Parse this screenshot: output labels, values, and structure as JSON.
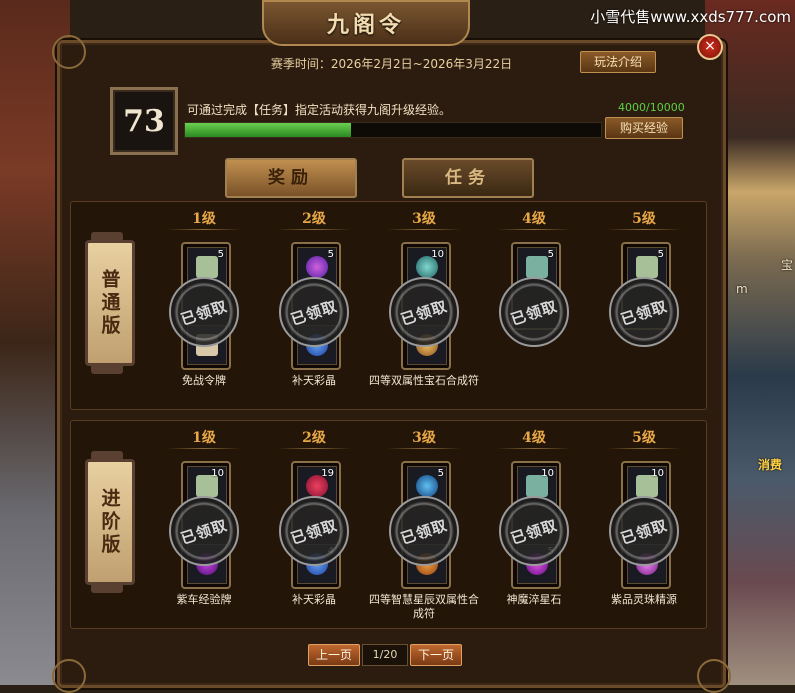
{
  "watermark": "小雪代售www.xxds777.com",
  "side_texts": {
    "left_sym": "宝",
    "right_m": "m",
    "right_consume": "消费"
  },
  "window": {
    "title": "九阁令",
    "close": "×",
    "season": "赛季时间：2026年2月2日~2026年3月22日",
    "rules_button": "玩法介绍",
    "level": "73",
    "exp_desc": "可通过完成【任务】指定活动获得九阁升级经验。",
    "exp_count": "4000/10000",
    "exp_progress": 0.4,
    "buy_button": "购买经验",
    "tabs": [
      "奖励",
      "任务"
    ]
  },
  "tiers": [
    {
      "label": "普通版",
      "columns": [
        {
          "level": "1级",
          "top_count": "5",
          "bottom_count": "",
          "name": "免战令牌",
          "claimed": "已领取"
        },
        {
          "level": "2级",
          "top_count": "5",
          "bottom_count": "",
          "name": "补天彩晶",
          "claimed": "已领取"
        },
        {
          "level": "3级",
          "top_count": "10",
          "bottom_count": "",
          "name": "四等双属性宝石合成符",
          "claimed": "已领取"
        },
        {
          "level": "4级",
          "top_count": "5",
          "bottom_count": "",
          "name": "",
          "claimed": "已领取"
        },
        {
          "level": "5级",
          "top_count": "5",
          "bottom_count": "",
          "name": "",
          "claimed": "已领取"
        }
      ]
    },
    {
      "label": "进阶版",
      "columns": [
        {
          "level": "1级",
          "top_count": "10",
          "bottom_count": "",
          "name": "紫车经验牌",
          "claimed": "已领取"
        },
        {
          "level": "2级",
          "top_count": "19",
          "bottom_count": "4",
          "name": "补天彩晶",
          "claimed": "已领取"
        },
        {
          "level": "3级",
          "top_count": "5",
          "bottom_count": "",
          "name": "四等智慧星辰双属性合成符",
          "claimed": "已领取"
        },
        {
          "level": "4级",
          "top_count": "10",
          "bottom_count": "5",
          "name": "神魔淬星石",
          "claimed": "已领取"
        },
        {
          "level": "5级",
          "top_count": "10",
          "bottom_count": "",
          "name": "紫品灵珠精源",
          "claimed": "已领取"
        }
      ]
    }
  ],
  "pager": {
    "prev": "上一页",
    "page": "1/20",
    "next": "下一页"
  },
  "colors": {
    "level_label": "#e8a848",
    "progress_fill": "#4ab83a",
    "claimed_seal": "#9a9a9a"
  }
}
